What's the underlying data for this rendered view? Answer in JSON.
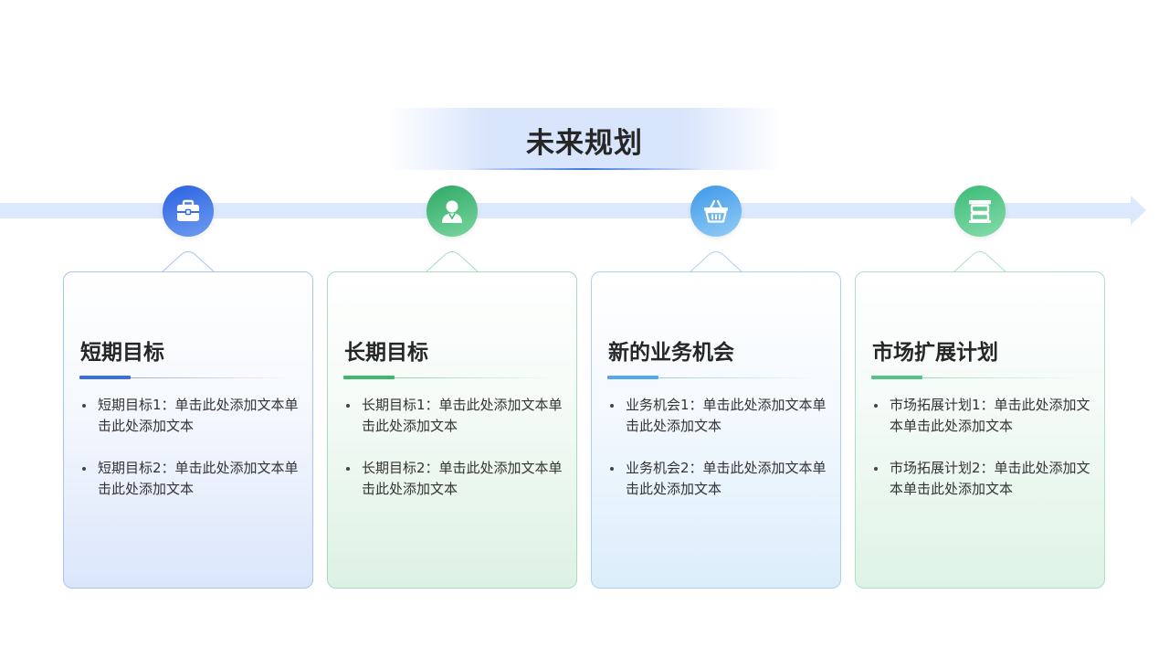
{
  "page": {
    "title": "未来规划"
  },
  "cards": [
    {
      "title": "短期目标",
      "icon": "briefcase-icon",
      "accent": "#3b6fe0",
      "items": [
        "短期目标1：单击此处添加文本单击此处添加文本",
        "短期目标2：单击此处添加文本单击此处添加文本"
      ]
    },
    {
      "title": "长期目标",
      "icon": "person-icon",
      "accent": "#3fb86e",
      "items": [
        "长期目标1：单击此处添加文本单击此处添加文本",
        "长期目标2：单击此处添加文本单击此处添加文本"
      ]
    },
    {
      "title": "新的业务机会",
      "icon": "basket-icon",
      "accent": "#52a8ea",
      "items": [
        "业务机会1：单击此处添加文本单击此处添加文本",
        "业务机会2：单击此处添加文本单击此处添加文本"
      ]
    },
    {
      "title": "市场扩展计划",
      "icon": "store-icon",
      "accent": "#54c486",
      "items": [
        "市场拓展计划1：单击此处添加文本单击此处添加文本",
        "市场拓展计划2：单击此处添加文本单击此处添加文本"
      ]
    }
  ]
}
